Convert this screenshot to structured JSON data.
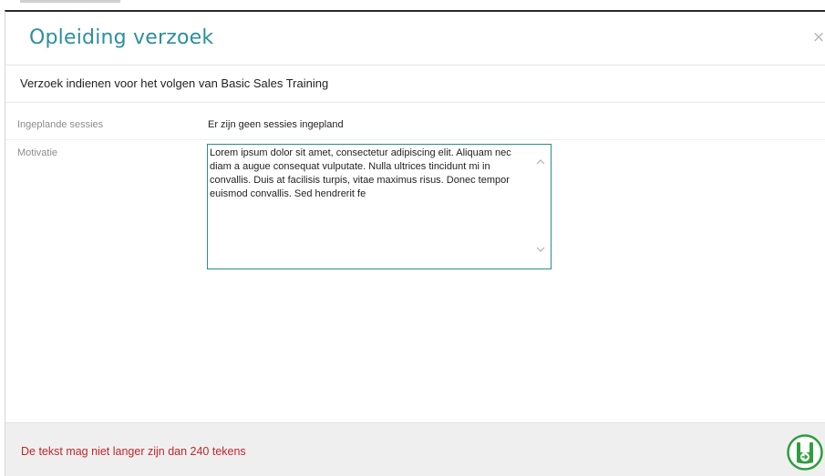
{
  "modal": {
    "title": "Opleiding verzoek",
    "close_glyph": "×",
    "subtitle": "Verzoek indienen voor het volgen van Basic Sales Training"
  },
  "fields": {
    "sessions": {
      "label": "Ingeplande sessies",
      "value": "Er zijn geen sessies ingepland"
    },
    "motivation": {
      "label": "Motivatie",
      "value": "Lorem ipsum dolor sit amet, consectetur adipiscing elit. Aliquam nec diam a augue consequat vulputate. Nulla ultrices tincidunt mi in convallis. Duis at facilisis turpis, vitae maximus risus. Donec tempor euismod convallis. Sed hendrerit fe"
    }
  },
  "footer": {
    "error_message": "De tekst mag niet langer zijn dan 240 tekens",
    "submit_icon": "submit-request-icon"
  },
  "colors": {
    "title": "#2b8fa0",
    "textarea_border": "#2b8f83",
    "error": "#c0272d",
    "submit_icon": "#2e9e3e",
    "footer_bg": "#efefef"
  }
}
